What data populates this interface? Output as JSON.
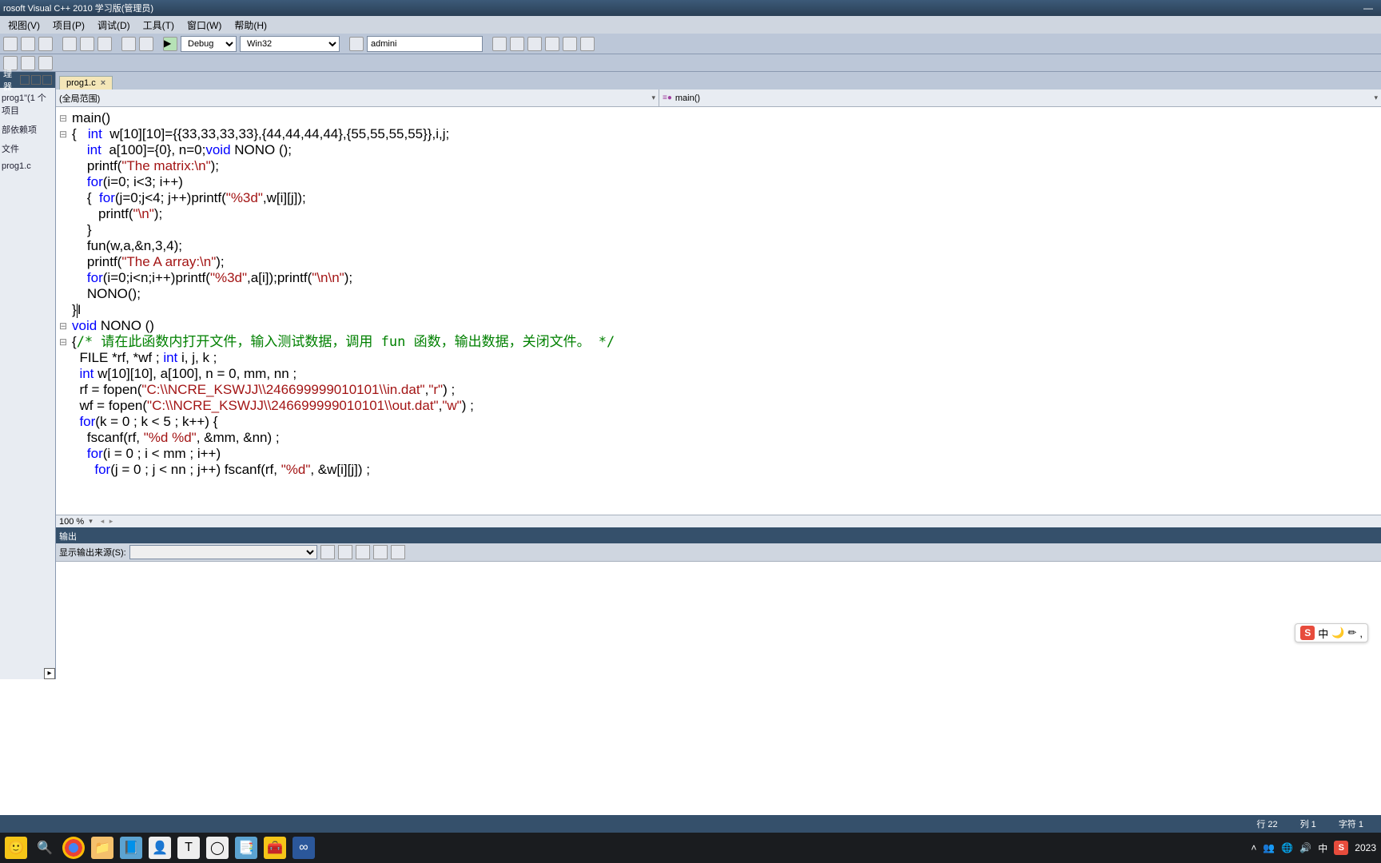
{
  "window": {
    "title": "rosoft Visual C++ 2010 学习版(管理员)"
  },
  "menus": [
    "视图(V)",
    "项目(P)",
    "调试(D)",
    "工具(T)",
    "窗口(W)",
    "帮助(H)"
  ],
  "toolbar": {
    "config": "Debug",
    "platform": "Win32",
    "find": "admini"
  },
  "sidebar": {
    "header": "理器",
    "items": [
      "prog1\"(1 个项目",
      "部依赖项",
      "文件",
      "prog1.c"
    ]
  },
  "tab": {
    "name": "prog1.c"
  },
  "scope": {
    "left": "(全局范围)",
    "right": "main()"
  },
  "zoom": "100 %",
  "code_lines": [
    {
      "fold": "⊟",
      "html": "main()"
    },
    {
      "fold": "⊟",
      "html": "{   <span class='typ'>int</span>  w[10][10]={{33,33,33,33},{44,44,44,44},{55,55,55,55}},i,j;"
    },
    {
      "fold": "",
      "html": "    <span class='typ'>int</span>  a[100]={0}, n=0;<span class='typ'>void</span> NONO ();"
    },
    {
      "fold": "",
      "html": "    printf(<span class='str'>\"The matrix:\\n\"</span>);"
    },
    {
      "fold": "",
      "html": "    <span class='kw'>for</span>(i=0; i&lt;3; i++)"
    },
    {
      "fold": "",
      "html": "    {  <span class='kw'>for</span>(j=0;j&lt;4; j++)printf(<span class='str'>\"%3d\"</span>,w[i][j]);"
    },
    {
      "fold": "",
      "html": "       printf(<span class='str'>\"\\n\"</span>);"
    },
    {
      "fold": "",
      "html": "    }"
    },
    {
      "fold": "",
      "html": "    fun(w,a,&amp;n,3,4);"
    },
    {
      "fold": "",
      "html": "    printf(<span class='str'>\"The A array:\\n\"</span>);"
    },
    {
      "fold": "",
      "html": "    <span class='kw'>for</span>(i=0;i&lt;n;i++)printf(<span class='str'>\"%3d\"</span>,a[i]);printf(<span class='str'>\"\\n\\n\"</span>);"
    },
    {
      "fold": "",
      "html": "    NONO();"
    },
    {
      "fold": "",
      "html": "}<span class='cursor-caret'></span>I"
    },
    {
      "fold": "⊟",
      "html": "<span class='typ'>void</span> NONO ()"
    },
    {
      "fold": "⊟",
      "html": "{<span class='com'>/* 请在此函数内打开文件，输入测试数据，调用 fun 函数，输出数据，关闭文件。 */</span>"
    },
    {
      "fold": "",
      "html": "  FILE *rf, *wf ; <span class='typ'>int</span> i, j, k ;"
    },
    {
      "fold": "",
      "html": "  <span class='typ'>int</span> w[10][10], a[100], n = 0, mm, nn ;"
    },
    {
      "fold": "",
      "html": "  rf = fopen(<span class='str'>\"C:\\\\NCRE_KSWJJ\\\\246699999010101\\\\in.dat\"</span>,<span class='str'>\"r\"</span>) ;"
    },
    {
      "fold": "",
      "html": "  wf = fopen(<span class='str'>\"C:\\\\NCRE_KSWJJ\\\\246699999010101\\\\out.dat\"</span>,<span class='str'>\"w\"</span>) ;"
    },
    {
      "fold": "",
      "html": "  <span class='kw'>for</span>(k = 0 ; k &lt; 5 ; k++) {"
    },
    {
      "fold": "",
      "html": "    fscanf(rf, <span class='str'>\"%d %d\"</span>, &amp;mm, &amp;nn) ;"
    },
    {
      "fold": "",
      "html": "    <span class='kw'>for</span>(i = 0 ; i &lt; mm ; i++)"
    },
    {
      "fold": "",
      "html": "      <span class='kw'>for</span>(j = 0 ; j &lt; nn ; j++) fscanf(rf, <span class='str'>\"%d\"</span>, &amp;w[i][j]) ;"
    }
  ],
  "output": {
    "title": "输出",
    "source_label": "显示输出来源(S):"
  },
  "ime": {
    "lang": "中",
    "icons": [
      "🌙",
      "✏",
      ","
    ]
  },
  "status": {
    "line": "行 22",
    "col": "列 1",
    "char": "字符 1"
  },
  "tray": {
    "lang": "中",
    "time_suffix": "2023"
  }
}
